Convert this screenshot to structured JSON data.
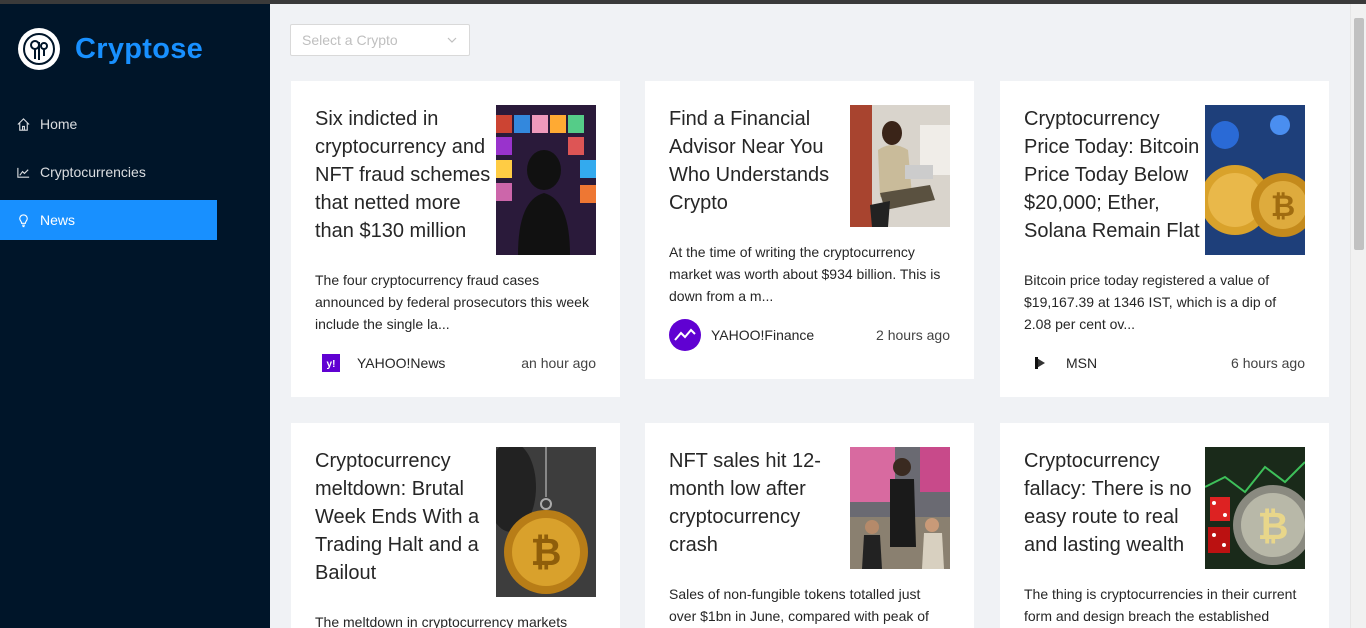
{
  "brand": {
    "name": "Cryptose"
  },
  "menu": [
    {
      "label": "Home",
      "icon": "home-icon"
    },
    {
      "label": "Cryptocurrencies",
      "icon": "chart-icon"
    },
    {
      "label": "News",
      "icon": "bulb-icon",
      "active": true
    }
  ],
  "filter": {
    "placeholder": "Select a Crypto"
  },
  "cards": [
    {
      "title": "Six indicted in cryptocurrency and NFT fraud schemes that netted more than $130 million",
      "desc": "The four cryptocurrency fraud cases announced by federal prosecutors this week include the single la...",
      "provider": "YAHOO!News",
      "time": "an hour ago"
    },
    {
      "title": "Find a Financial Advisor Near You Who Understands Crypto",
      "desc": "At the time of writing the cryptocurrency market was worth about $934 billion. This is down from a m...",
      "provider": "YAHOO!Finance",
      "time": "2 hours ago"
    },
    {
      "title": "Cryptocurrency Price Today: Bitcoin Price Today Below $20,000; Ether, Solana Remain Flat",
      "desc": "Bitcoin price today registered a value of $19,167.39 at 1346 IST, which is a dip of 2.08 per cent ov...",
      "provider": "MSN",
      "time": "6 hours ago"
    },
    {
      "title": "Cryptocurrency meltdown: Brutal Week Ends With a Trading Halt and a Bailout",
      "desc": "The meltdown in cryptocurrency markets",
      "provider": "",
      "time": ""
    },
    {
      "title": "NFT sales hit 12-month low after cryptocurrency crash",
      "desc": "Sales of non-fungible tokens totalled just over $1bn in June, compared with peak of",
      "provider": "",
      "time": ""
    },
    {
      "title": "Cryptocurrency fallacy: There is no easy route to real and lasting wealth",
      "desc": "The thing is cryptocurrencies in their current form and design breach the established",
      "provider": "",
      "time": ""
    }
  ],
  "colors": {
    "sidebar": "#001529",
    "accent": "#1890ff",
    "yahoo": "#6001d2"
  }
}
